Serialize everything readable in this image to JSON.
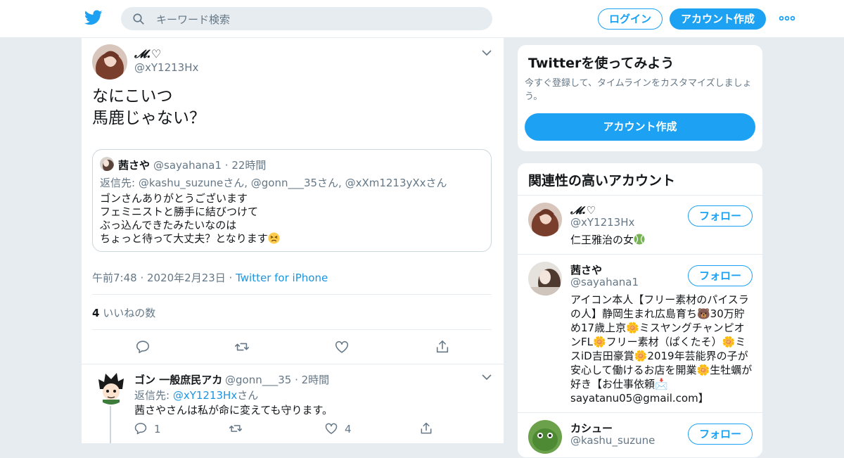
{
  "header": {
    "search_placeholder": "キーワード検索",
    "login_label": "ログイン",
    "signup_label": "アカウント作成"
  },
  "tweet": {
    "name": "𝓜.♡",
    "handle": "@xY1213Hx",
    "text": "なにこいつ\n馬鹿じゃない？",
    "quote": {
      "name": "茜さや",
      "meta": "@sayahana1 · 22時間",
      "reply_to": "返信先: @kashu_suzuneさん, @gonn___35さん, @xXm1213yXxさん",
      "text": "ゴンさんありがとうございます\nフェミニストと勝手に結びつけて\nぶっ込んできたみたいなのは\nちょっと待って大丈夫？となります"
    },
    "timestamp": "午前7:48 · 2020年2月23日 · ",
    "source": "Twitter for iPhone",
    "like_count": "4",
    "like_label": " いいねの数"
  },
  "reply": {
    "name": "ゴン 一般庶民アカ",
    "meta": "@gonn___35 · 2時間",
    "reply_prefix": "返信先: ",
    "reply_handle": "@xY1213Hx",
    "reply_suffix": "さん",
    "text": "茜さやさんは私が命に変えても守ります。",
    "reply_count": "1",
    "like_count": "4"
  },
  "sidebar": {
    "signup_card": {
      "title": "Twitterを使ってみよう",
      "desc": "今すぐ登録して、タイムラインをカスタマイズしましょう。",
      "button": "アカウント作成"
    },
    "related": {
      "title": "関連性の高いアカウント",
      "follow_label": "フォロー",
      "accounts": [
        {
          "name": "𝓜.♡",
          "handle": "@xY1213Hx",
          "bio": "仁王雅治の女"
        },
        {
          "name": "茜さや",
          "handle": "@sayahana1",
          "bio": "アイコン本人【フリー素材のパイスラの人】静岡生まれ広島育ち🐻30万貯め17歳上京🌼ミスヤングチャンピオンFL🌼フリー素材（ぱくたそ）🌼ミスiD吉田豪賞🌼2019年芸能界の子が安心して働けるお店を開業🌼生牡蠣が好き【お仕事依頼📩sayatanu05@gmail.com】"
        },
        {
          "name": "カシュー",
          "handle": "@kashu_suzune",
          "bio": ""
        }
      ]
    }
  },
  "colors": {
    "brand": "#1da1f2",
    "link": "#1b95e0",
    "muted": "#657786",
    "bg": "#e6ecf0"
  },
  "icons": [
    "twitter-bird-icon",
    "search-icon",
    "more-dots-icon",
    "chevron-down-icon",
    "reply-icon",
    "retweet-icon",
    "like-icon",
    "share-icon",
    "tennis-ball-icon",
    "persevering-face-icon"
  ]
}
